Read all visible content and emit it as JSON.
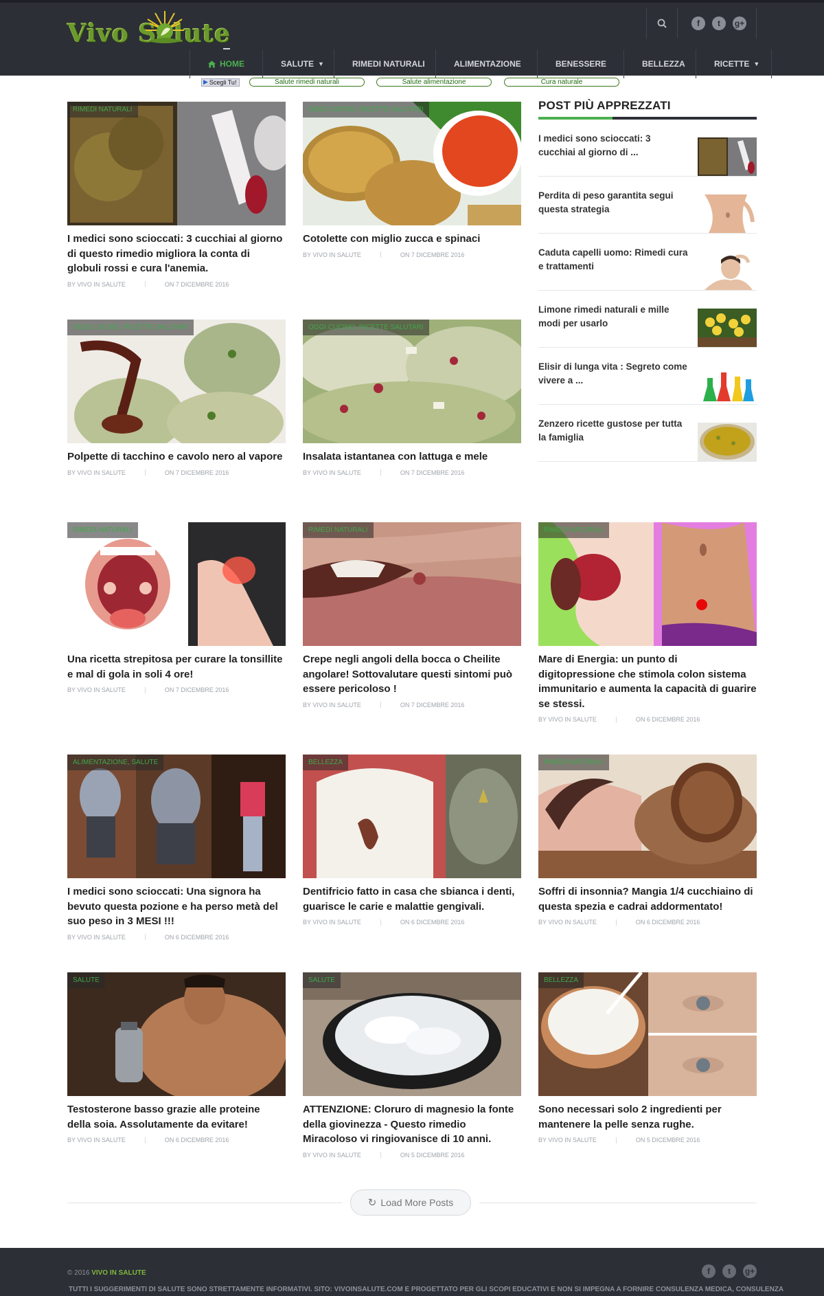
{
  "header": {
    "logo_text": "Vivo   Salute",
    "nav": [
      {
        "label": "HOME",
        "icon": "home-icon"
      },
      {
        "label": "SALUTE",
        "caret": true
      },
      {
        "label": "RIMEDI NATURALI"
      },
      {
        "label": "ALIMENTAZIONE"
      },
      {
        "label": "BENESSERE"
      },
      {
        "label": "BELLEZZA"
      },
      {
        "label": "RICETTE",
        "caret": true
      }
    ],
    "social": [
      "f",
      "t",
      "g+"
    ]
  },
  "sublinks": {
    "scegli": "Scegli Tu!",
    "pills": [
      "Salute rimedi naturali",
      "Salute alimentazione",
      "Cura naturale"
    ]
  },
  "articles": [
    {
      "category": "RIMEDI NATURALI",
      "title": "I medici sono scioccati: 3 cucchiai al giorno di questo rimedio migliora la conta di globuli rossi e cura l'anemia.",
      "author": "BY VIVO IN SALUTE",
      "date": "ON 7 DICEMBRE 2016"
    },
    {
      "category": "OGGI CUCINO, RICETTE SALUTARI",
      "title": "Cotolette con miglio zucca e spinaci",
      "author": "BY VIVO IN SALUTE",
      "date": "ON 7 DICEMBRE 2016"
    },
    {
      "category": "OGGI CUCINO, RICETTE SALUTARI",
      "title": "Polpette di tacchino e cavolo nero al vapore",
      "author": "BY VIVO IN SALUTE",
      "date": "ON 7 DICEMBRE 2016"
    },
    {
      "category": "OGGI CUCINO, RICETTE SALUTARI",
      "title": "Insalata istantanea con lattuga e mele",
      "author": "BY VIVO IN SALUTE",
      "date": "ON 7 DICEMBRE 2016"
    },
    {
      "category": "RIMEDI NATURALI",
      "title": "Una ricetta strepitosa per curare la tonsillite e mal di gola in soli 4 ore!",
      "author": "BY VIVO IN SALUTE",
      "date": "ON 7 DICEMBRE 2016"
    },
    {
      "category": "RIMEDI NATURALI",
      "title": "Crepe negli angoli della bocca o Cheilite angolare! Sottovalutare questi sintomi può essere pericoloso !",
      "author": "BY VIVO IN SALUTE",
      "date": "ON 7 DICEMBRE 2016"
    },
    {
      "category": "RIMEDI NATURALI",
      "title": "Mare di Energia: un punto di digitopressione che stimola colon sistema immunitario e aumenta la capacità di guarire se stessi.",
      "author": "BY VIVO IN SALUTE",
      "date": "ON 6 DICEMBRE 2016"
    },
    {
      "category": "ALIMENTAZIONE, SALUTE",
      "title": "I medici sono scioccati: Una signora ha bevuto questa pozione e ha perso metà del suo peso in 3 MESI !!!",
      "author": "BY VIVO IN SALUTE",
      "date": "ON 6 DICEMBRE 2016"
    },
    {
      "category": "BELLEZZA",
      "title": "Dentifricio fatto in casa che sbianca i denti, guarisce le carie e malattie gengivali.",
      "author": "BY VIVO IN SALUTE",
      "date": "ON 6 DICEMBRE 2016"
    },
    {
      "category": "RIMEDI NATURALI",
      "title": "Soffri di insonnia? Mangia 1/4 cucchiaino di questa spezia e cadrai addormentato!",
      "author": "BY VIVO IN SALUTE",
      "date": "ON 6 DICEMBRE 2016"
    },
    {
      "category": "SALUTE",
      "title": "Testosterone basso grazie alle proteine della soia. Assolutamente da evitare!",
      "author": "BY VIVO IN SALUTE",
      "date": "ON 6 DICEMBRE 2016"
    },
    {
      "category": "SALUTE",
      "title": "ATTENZIONE: Cloruro di magnesio la fonte della giovinezza - Questo rimedio Miracoloso vi ringiovanisce di 10 anni.",
      "author": "BY VIVO IN SALUTE",
      "date": "ON 5 DICEMBRE 2016"
    },
    {
      "category": "BELLEZZA",
      "title": "Sono necessari solo 2 ingredienti per mantenere la pelle senza rughe.",
      "author": "BY VIVO IN SALUTE",
      "date": "ON 5 DICEMBRE 2016"
    }
  ],
  "sidebar": {
    "title": "POST PIÙ APPREZZATI",
    "items": [
      {
        "title": "I medici sono scioccati: 3 cucchiai al giorno di ..."
      },
      {
        "title": "Perdita di peso garantita segui questa strategia"
      },
      {
        "title": "Caduta capelli uomo: Rimedi cura e trattamenti"
      },
      {
        "title": "Limone rimedi naturali e mille modi per usarlo"
      },
      {
        "title": "Elisir di lunga vita : Segreto come vivere a ..."
      },
      {
        "title": "Zenzero ricette gustose per tutta la famiglia"
      }
    ]
  },
  "load_more": "Load More Posts",
  "footer": {
    "copyright_prefix": "© 2016",
    "brand": "VIVO IN SALUTE",
    "disclaimer": "TUTTI I SUGGERIMENTI DI SALUTE SONO STRETTAMENTE INFORMATIVI. SITO: VIVOINSALUTE.COM È PROGETTATO PER GLI SCOPI EDUCATIVI E NON SI IMPEGNA A FORNIRE CONSULENZA MEDICA, CONSULENZA",
    "social": [
      "f",
      "t",
      "g+"
    ]
  },
  "colors": {
    "accent": "#4caf50",
    "header_bg": "#2c2f36",
    "pill_border": "#3c7a1a"
  }
}
